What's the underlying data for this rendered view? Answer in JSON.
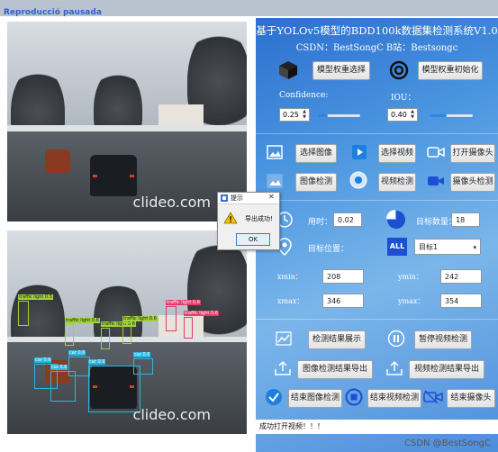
{
  "window": {
    "overlay_label": "Reproducció pausada"
  },
  "video_top": {
    "watermark": "clideo.com"
  },
  "video_bottom": {
    "watermark": "clideo.com",
    "detections": [
      {
        "label": "traffic light 0.5",
        "color": "green"
      },
      {
        "label": "traffic light 0.6",
        "color": "green"
      },
      {
        "label": "traffic light 0.6",
        "color": "green"
      },
      {
        "label": "traffic light 0.6",
        "color": "green"
      },
      {
        "label": "traffic light 0.6",
        "color": "red"
      },
      {
        "label": "traffic light 0.6",
        "color": "red"
      },
      {
        "label": "car 0.6",
        "color": "blue"
      },
      {
        "label": "car 0.6",
        "color": "blue"
      },
      {
        "label": "car 0.9",
        "color": "blue"
      },
      {
        "label": "car 0.6",
        "color": "blue"
      },
      {
        "label": "car 0.6",
        "color": "blue"
      }
    ]
  },
  "header": {
    "title": "基于YOLOv5模型的BDD100k数据集检测系统V1.0",
    "subtitle": "CSDN：BestSongC   B站：Bestsongc"
  },
  "model": {
    "select_weights": "模型权重选择",
    "init_weights": "模型权重初始化",
    "confidence_label": "Confidence:",
    "confidence_value": "0.25",
    "confidence_level": 0.25,
    "iou_label": "IOU：",
    "iou_value": "0.40",
    "iou_level": 0.4
  },
  "actions": {
    "select_image": "选择图像",
    "select_video": "选择视频",
    "open_camera": "打开摄像头",
    "detect_image": "图像检测",
    "detect_video": "视频检测",
    "detect_camera": "摄像头检测"
  },
  "stats": {
    "time_label": "用时：",
    "time_value": "0.02",
    "count_label": "目标数量：",
    "count_value": "18",
    "position_label": "目标位置：",
    "target_select": "目标1",
    "all_badge": "ALL",
    "xmin_label": "xmin：",
    "xmin_value": "208",
    "ymin_label": "ymin：",
    "ymin_value": "242",
    "xmax_label": "xmax：",
    "xmax_value": "346",
    "ymax_label": "ymax：",
    "ymax_value": "354"
  },
  "results": {
    "show_results": "检测结果展示",
    "pause_video": "暂停视频检测",
    "export_image": "图像检测结果导出",
    "export_video": "视频检测结果导出",
    "end_image": "结束图像检测",
    "end_video": "结束视频检测",
    "end_camera": "结束摄像头"
  },
  "status_text": "成功打开视频！！！",
  "credit": "CSDN @BestSongC",
  "dialog": {
    "title": "提示",
    "message": "导出成功!",
    "ok": "OK",
    "close": "✕"
  },
  "colors": {
    "panel_blue": "#4a95e0",
    "slider_blue": "#2e86de",
    "det_blue": "#29b8e0",
    "det_green": "#9fd23a",
    "det_red": "#e23c6a"
  }
}
